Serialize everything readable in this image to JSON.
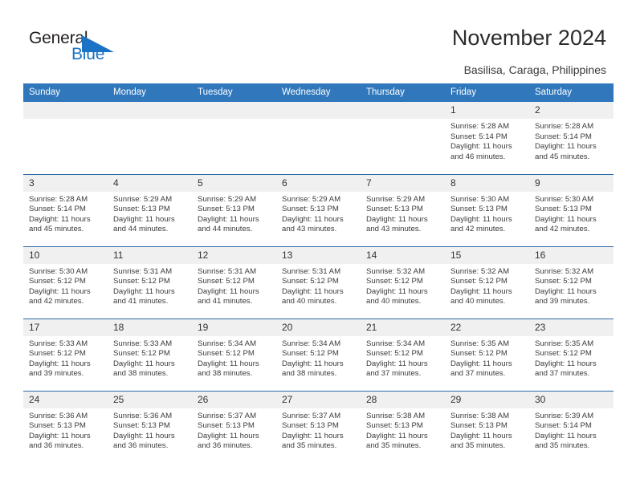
{
  "brand": {
    "name_dark": "General",
    "name_blue": "Blue",
    "triangle_color": "#1a73c4",
    "text_color": "#231f20"
  },
  "header": {
    "title": "November 2024",
    "subtitle": "Basilisa, Caraga, Philippines",
    "header_bg": "#3077bc",
    "daynum_bg": "#f0f0f0",
    "row_border": "#2a69a8"
  },
  "weekdays": [
    "Sunday",
    "Monday",
    "Tuesday",
    "Wednesday",
    "Thursday",
    "Friday",
    "Saturday"
  ],
  "weeks": [
    [
      {
        "day": "",
        "sunrise": "",
        "sunset": "",
        "daylight1": "",
        "daylight2": ""
      },
      {
        "day": "",
        "sunrise": "",
        "sunset": "",
        "daylight1": "",
        "daylight2": ""
      },
      {
        "day": "",
        "sunrise": "",
        "sunset": "",
        "daylight1": "",
        "daylight2": ""
      },
      {
        "day": "",
        "sunrise": "",
        "sunset": "",
        "daylight1": "",
        "daylight2": ""
      },
      {
        "day": "",
        "sunrise": "",
        "sunset": "",
        "daylight1": "",
        "daylight2": ""
      },
      {
        "day": "1",
        "sunrise": "Sunrise: 5:28 AM",
        "sunset": "Sunset: 5:14 PM",
        "daylight1": "Daylight: 11 hours",
        "daylight2": "and 46 minutes."
      },
      {
        "day": "2",
        "sunrise": "Sunrise: 5:28 AM",
        "sunset": "Sunset: 5:14 PM",
        "daylight1": "Daylight: 11 hours",
        "daylight2": "and 45 minutes."
      }
    ],
    [
      {
        "day": "3",
        "sunrise": "Sunrise: 5:28 AM",
        "sunset": "Sunset: 5:14 PM",
        "daylight1": "Daylight: 11 hours",
        "daylight2": "and 45 minutes."
      },
      {
        "day": "4",
        "sunrise": "Sunrise: 5:29 AM",
        "sunset": "Sunset: 5:13 PM",
        "daylight1": "Daylight: 11 hours",
        "daylight2": "and 44 minutes."
      },
      {
        "day": "5",
        "sunrise": "Sunrise: 5:29 AM",
        "sunset": "Sunset: 5:13 PM",
        "daylight1": "Daylight: 11 hours",
        "daylight2": "and 44 minutes."
      },
      {
        "day": "6",
        "sunrise": "Sunrise: 5:29 AM",
        "sunset": "Sunset: 5:13 PM",
        "daylight1": "Daylight: 11 hours",
        "daylight2": "and 43 minutes."
      },
      {
        "day": "7",
        "sunrise": "Sunrise: 5:29 AM",
        "sunset": "Sunset: 5:13 PM",
        "daylight1": "Daylight: 11 hours",
        "daylight2": "and 43 minutes."
      },
      {
        "day": "8",
        "sunrise": "Sunrise: 5:30 AM",
        "sunset": "Sunset: 5:13 PM",
        "daylight1": "Daylight: 11 hours",
        "daylight2": "and 42 minutes."
      },
      {
        "day": "9",
        "sunrise": "Sunrise: 5:30 AM",
        "sunset": "Sunset: 5:13 PM",
        "daylight1": "Daylight: 11 hours",
        "daylight2": "and 42 minutes."
      }
    ],
    [
      {
        "day": "10",
        "sunrise": "Sunrise: 5:30 AM",
        "sunset": "Sunset: 5:12 PM",
        "daylight1": "Daylight: 11 hours",
        "daylight2": "and 42 minutes."
      },
      {
        "day": "11",
        "sunrise": "Sunrise: 5:31 AM",
        "sunset": "Sunset: 5:12 PM",
        "daylight1": "Daylight: 11 hours",
        "daylight2": "and 41 minutes."
      },
      {
        "day": "12",
        "sunrise": "Sunrise: 5:31 AM",
        "sunset": "Sunset: 5:12 PM",
        "daylight1": "Daylight: 11 hours",
        "daylight2": "and 41 minutes."
      },
      {
        "day": "13",
        "sunrise": "Sunrise: 5:31 AM",
        "sunset": "Sunset: 5:12 PM",
        "daylight1": "Daylight: 11 hours",
        "daylight2": "and 40 minutes."
      },
      {
        "day": "14",
        "sunrise": "Sunrise: 5:32 AM",
        "sunset": "Sunset: 5:12 PM",
        "daylight1": "Daylight: 11 hours",
        "daylight2": "and 40 minutes."
      },
      {
        "day": "15",
        "sunrise": "Sunrise: 5:32 AM",
        "sunset": "Sunset: 5:12 PM",
        "daylight1": "Daylight: 11 hours",
        "daylight2": "and 40 minutes."
      },
      {
        "day": "16",
        "sunrise": "Sunrise: 5:32 AM",
        "sunset": "Sunset: 5:12 PM",
        "daylight1": "Daylight: 11 hours",
        "daylight2": "and 39 minutes."
      }
    ],
    [
      {
        "day": "17",
        "sunrise": "Sunrise: 5:33 AM",
        "sunset": "Sunset: 5:12 PM",
        "daylight1": "Daylight: 11 hours",
        "daylight2": "and 39 minutes."
      },
      {
        "day": "18",
        "sunrise": "Sunrise: 5:33 AM",
        "sunset": "Sunset: 5:12 PM",
        "daylight1": "Daylight: 11 hours",
        "daylight2": "and 38 minutes."
      },
      {
        "day": "19",
        "sunrise": "Sunrise: 5:34 AM",
        "sunset": "Sunset: 5:12 PM",
        "daylight1": "Daylight: 11 hours",
        "daylight2": "and 38 minutes."
      },
      {
        "day": "20",
        "sunrise": "Sunrise: 5:34 AM",
        "sunset": "Sunset: 5:12 PM",
        "daylight1": "Daylight: 11 hours",
        "daylight2": "and 38 minutes."
      },
      {
        "day": "21",
        "sunrise": "Sunrise: 5:34 AM",
        "sunset": "Sunset: 5:12 PM",
        "daylight1": "Daylight: 11 hours",
        "daylight2": "and 37 minutes."
      },
      {
        "day": "22",
        "sunrise": "Sunrise: 5:35 AM",
        "sunset": "Sunset: 5:12 PM",
        "daylight1": "Daylight: 11 hours",
        "daylight2": "and 37 minutes."
      },
      {
        "day": "23",
        "sunrise": "Sunrise: 5:35 AM",
        "sunset": "Sunset: 5:12 PM",
        "daylight1": "Daylight: 11 hours",
        "daylight2": "and 37 minutes."
      }
    ],
    [
      {
        "day": "24",
        "sunrise": "Sunrise: 5:36 AM",
        "sunset": "Sunset: 5:13 PM",
        "daylight1": "Daylight: 11 hours",
        "daylight2": "and 36 minutes."
      },
      {
        "day": "25",
        "sunrise": "Sunrise: 5:36 AM",
        "sunset": "Sunset: 5:13 PM",
        "daylight1": "Daylight: 11 hours",
        "daylight2": "and 36 minutes."
      },
      {
        "day": "26",
        "sunrise": "Sunrise: 5:37 AM",
        "sunset": "Sunset: 5:13 PM",
        "daylight1": "Daylight: 11 hours",
        "daylight2": "and 36 minutes."
      },
      {
        "day": "27",
        "sunrise": "Sunrise: 5:37 AM",
        "sunset": "Sunset: 5:13 PM",
        "daylight1": "Daylight: 11 hours",
        "daylight2": "and 35 minutes."
      },
      {
        "day": "28",
        "sunrise": "Sunrise: 5:38 AM",
        "sunset": "Sunset: 5:13 PM",
        "daylight1": "Daylight: 11 hours",
        "daylight2": "and 35 minutes."
      },
      {
        "day": "29",
        "sunrise": "Sunrise: 5:38 AM",
        "sunset": "Sunset: 5:13 PM",
        "daylight1": "Daylight: 11 hours",
        "daylight2": "and 35 minutes."
      },
      {
        "day": "30",
        "sunrise": "Sunrise: 5:39 AM",
        "sunset": "Sunset: 5:14 PM",
        "daylight1": "Daylight: 11 hours",
        "daylight2": "and 35 minutes."
      }
    ]
  ]
}
